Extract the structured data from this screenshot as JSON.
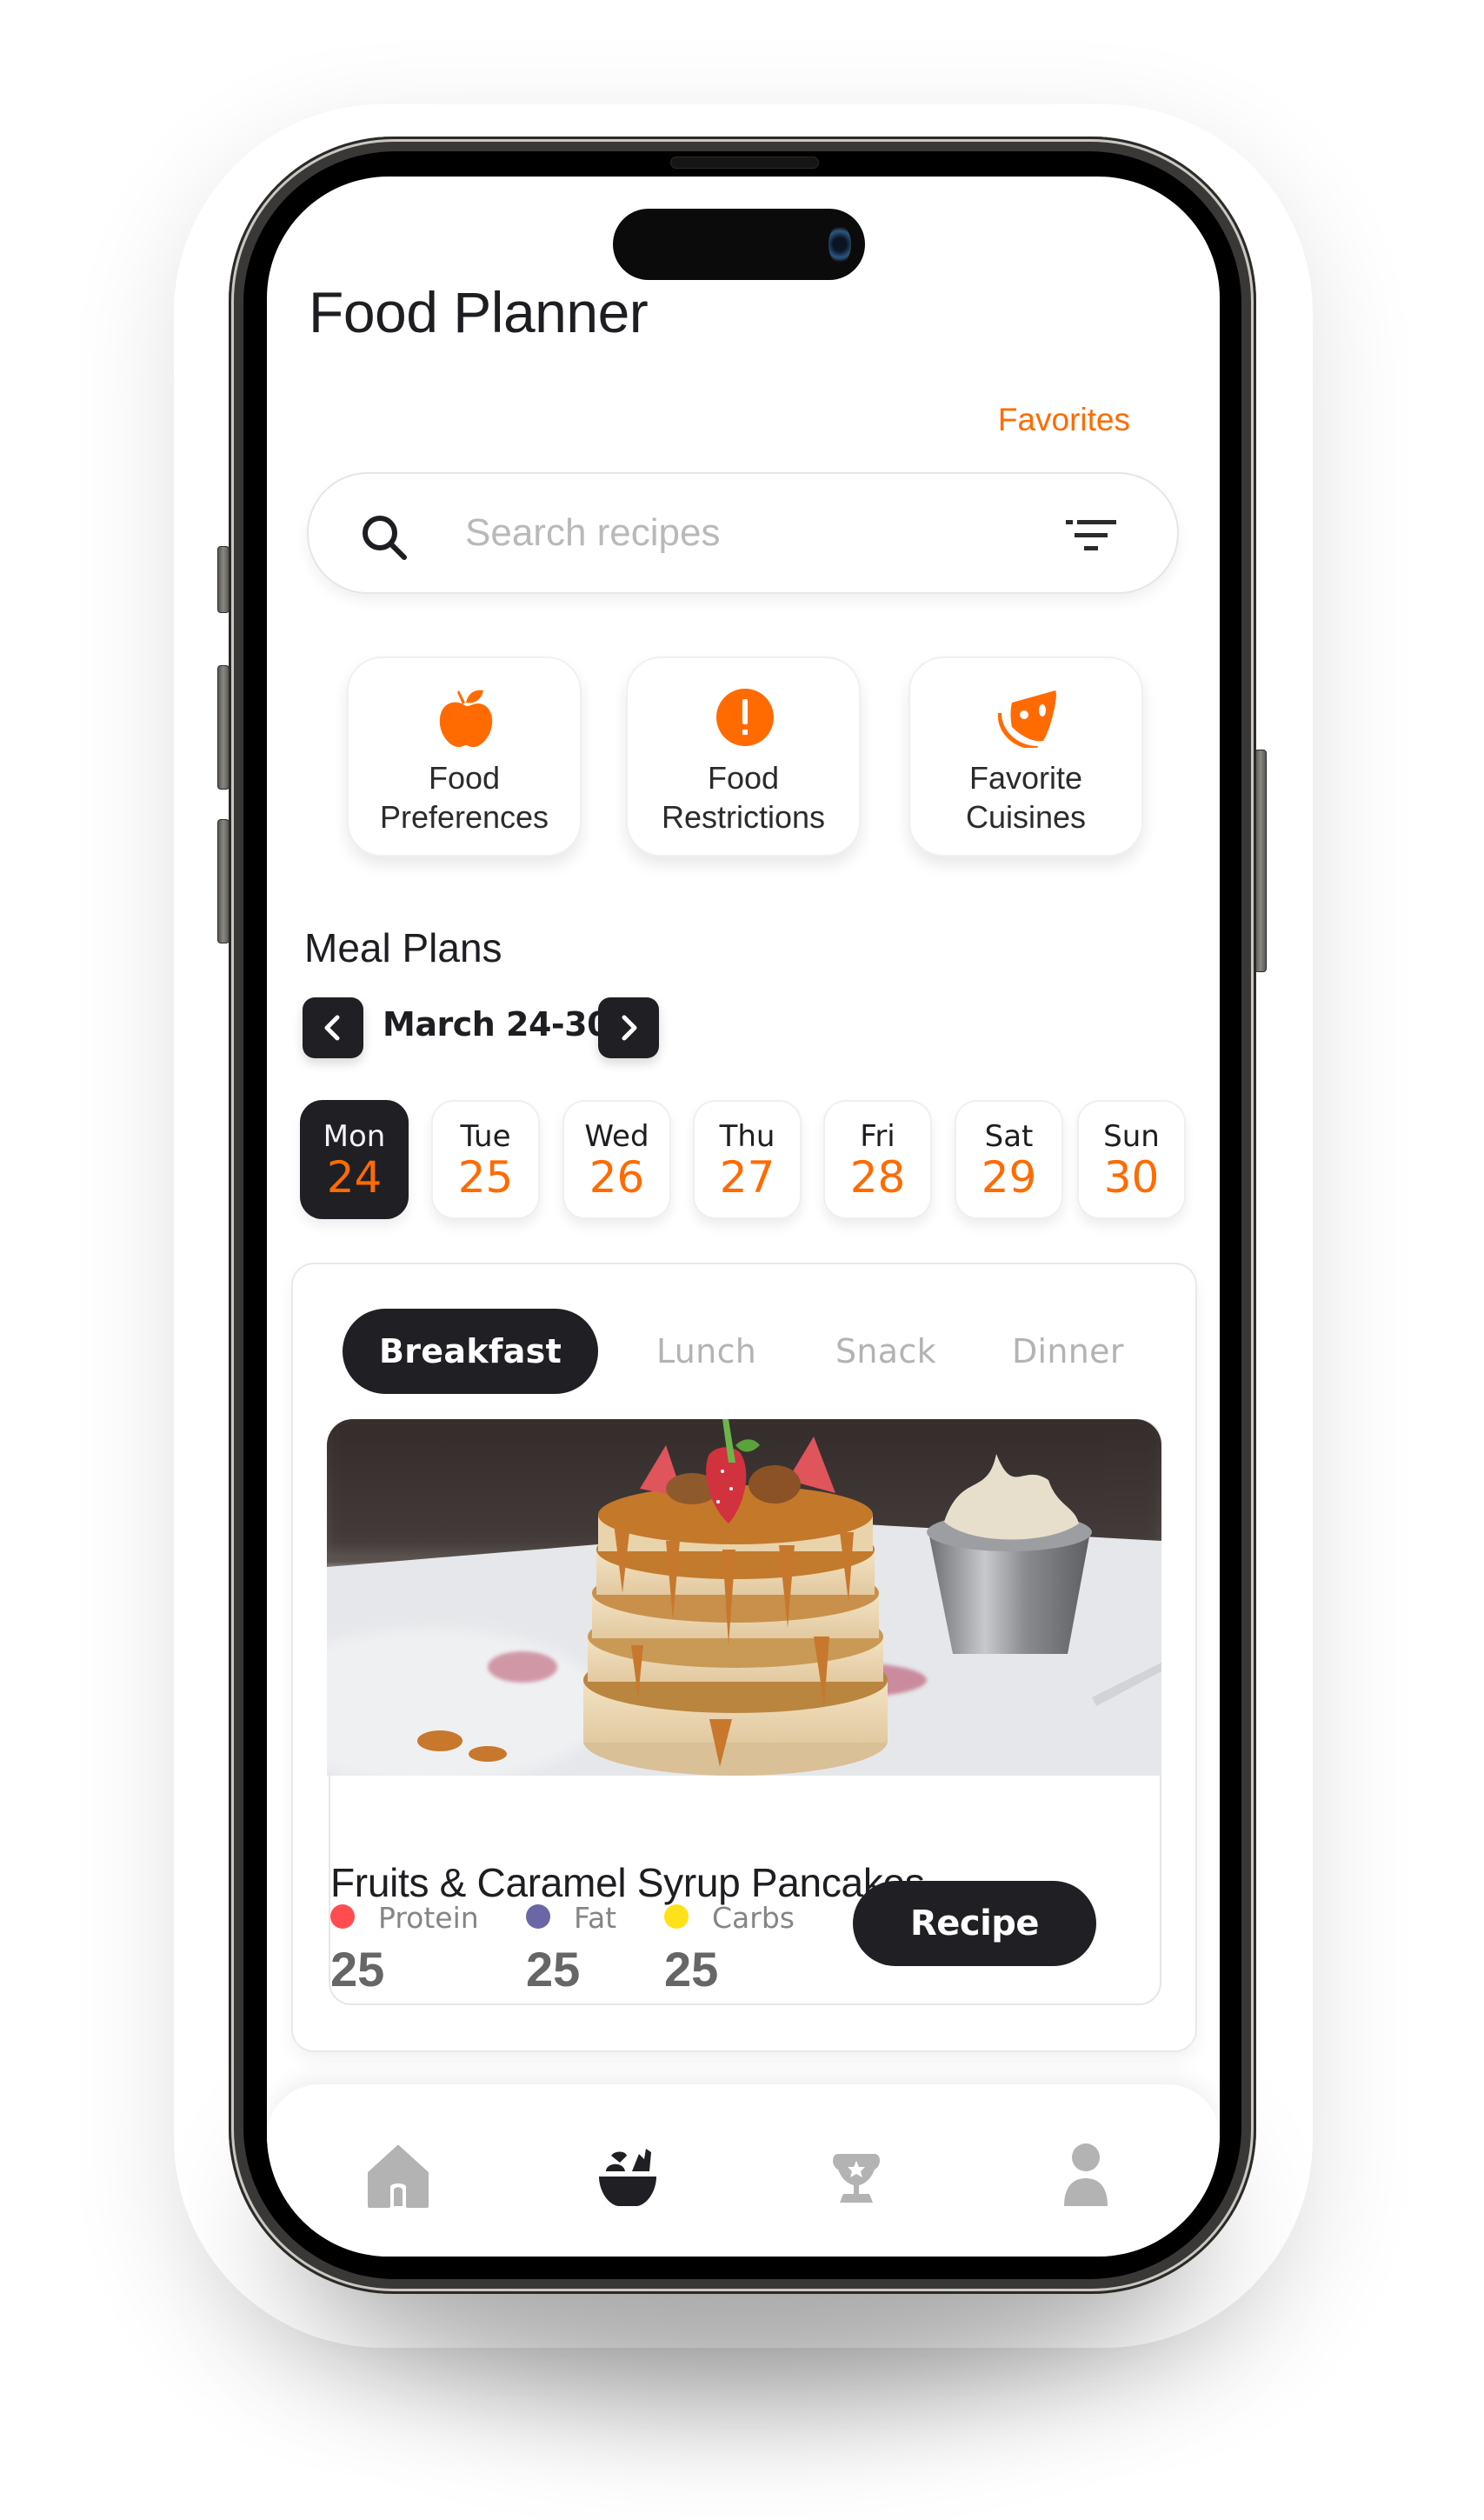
{
  "app": {
    "title": "Food Planner",
    "favorites_link": "Favorites"
  },
  "search": {
    "placeholder": "Search recipes",
    "value": "",
    "search_icon": "search-icon",
    "filter_icon": "filter-icon"
  },
  "categories": [
    {
      "line1": "Food",
      "line2": "Preferences",
      "icon": "apple-icon"
    },
    {
      "line1": "Food",
      "line2": "Restrictions",
      "icon": "alert-circle-icon"
    },
    {
      "line1": "Favorite",
      "line2": "Cuisines",
      "icon": "pizza-slice-icon"
    }
  ],
  "meal_plans": {
    "title": "Meal Plans",
    "week_label": "March 24-30",
    "prev_icon": "chevron-left-icon",
    "next_icon": "chevron-right-icon",
    "days": [
      {
        "name": "Mon",
        "date": "24",
        "selected": true
      },
      {
        "name": "Tue",
        "date": "25",
        "selected": false
      },
      {
        "name": "Wed",
        "date": "26",
        "selected": false
      },
      {
        "name": "Thu",
        "date": "27",
        "selected": false
      },
      {
        "name": "Fri",
        "date": "28",
        "selected": false
      },
      {
        "name": "Sat",
        "date": "29",
        "selected": false
      },
      {
        "name": "Sun",
        "date": "30",
        "selected": false
      }
    ],
    "meal_tabs": [
      {
        "label": "Breakfast",
        "selected": true
      },
      {
        "label": "Lunch",
        "selected": false
      },
      {
        "label": "Snack",
        "selected": false
      },
      {
        "label": "Dinner",
        "selected": false
      }
    ],
    "recipe": {
      "title": "Fruits & Caramel Syrup Pancakes",
      "image": "pancakes-photo",
      "macros": [
        {
          "label": "Protein",
          "value": "25",
          "color": "#ff4d4f"
        },
        {
          "label": "Fat",
          "value": "25",
          "color": "#6b66a6"
        },
        {
          "label": "Carbs",
          "value": "25",
          "color": "#ffe11a"
        }
      ],
      "button_label": "Recipe"
    }
  },
  "nav": [
    {
      "name": "home",
      "icon": "home-icon",
      "active": false
    },
    {
      "name": "meals",
      "icon": "food-bowl-icon",
      "active": true
    },
    {
      "name": "achievements",
      "icon": "trophy-icon",
      "active": false
    },
    {
      "name": "profile",
      "icon": "person-icon",
      "active": false
    }
  ],
  "colors": {
    "accent": "#ff6b00",
    "dark": "#1f1f24",
    "inactive_icon": "#b3b3b3"
  }
}
